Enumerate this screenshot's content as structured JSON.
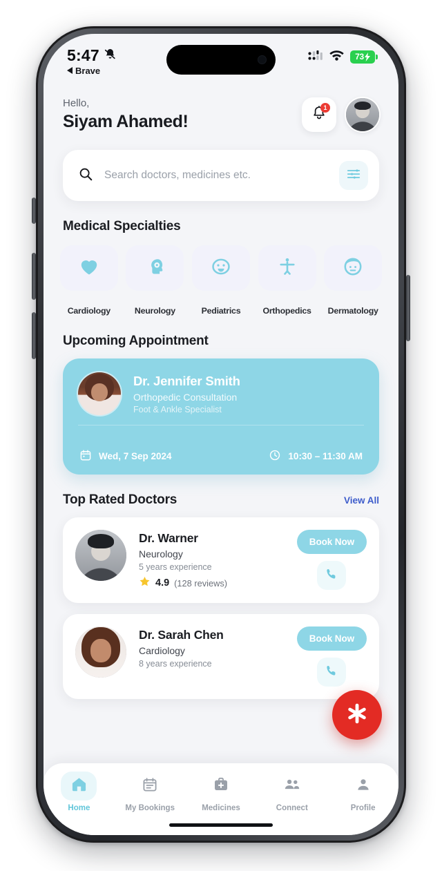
{
  "status_bar": {
    "time": "5:47",
    "silent_icon": "bell-slash-icon",
    "back_app_label": "Brave",
    "cellular_icon": "cellular-dots-icon",
    "wifi_icon": "wifi-icon",
    "battery_text": "73",
    "battery_color": "#2ad04f"
  },
  "header": {
    "greeting": "Hello,",
    "user_name": "Siyam Ahamed!",
    "notification_icon": "bell-icon",
    "notification_count": "1",
    "avatar_icon": "user-avatar"
  },
  "search": {
    "placeholder": "Search doctors, medicines etc.",
    "value": "",
    "search_icon": "search-icon",
    "filter_icon": "sliders-filter-icon"
  },
  "specialties": {
    "title": "Medical Specialties",
    "items": [
      {
        "label": "Cardiology",
        "icon": "heart-icon"
      },
      {
        "label": "Neurology",
        "icon": "brain-head-icon"
      },
      {
        "label": "Pediatrics",
        "icon": "baby-face-icon"
      },
      {
        "label": "Orthopedics",
        "icon": "body-person-icon"
      },
      {
        "label": "Dermatology",
        "icon": "face-skin-icon"
      }
    ]
  },
  "appointment": {
    "title": "Upcoming Appointment",
    "doctor_name": "Dr. Jennifer Smith",
    "consultation": "Orthopedic Consultation",
    "specialty_note": "Foot & Ankle Specialist",
    "date_icon": "calendar-icon",
    "date": "Wed, 7 Sep 2024",
    "time_icon": "clock-icon",
    "time": "10:30 – 11:30 AM",
    "card_color": "#8ed6e6"
  },
  "top_rated": {
    "title": "Top Rated Doctors",
    "view_all_label": "View All",
    "view_all_color": "#3d5ccb",
    "doctors": [
      {
        "name": "Dr. Warner",
        "specialty": "Neurology",
        "experience": "5 years experience",
        "rating": "4.9",
        "reviews": "(128 reviews)",
        "star_icon": "star-icon",
        "book_label": "Book Now",
        "call_icon": "phone-icon"
      },
      {
        "name": "Dr. Sarah Chen",
        "specialty": "Cardiology",
        "experience": "8 years experience",
        "rating": "",
        "reviews": "",
        "star_icon": "star-icon",
        "book_label": "Book Now",
        "call_icon": "phone-icon"
      }
    ]
  },
  "fab": {
    "icon": "emergency-asterisk-icon",
    "color": "#e32b24"
  },
  "bottom_nav": {
    "items": [
      {
        "label": "Home",
        "icon": "home-icon",
        "active": true
      },
      {
        "label": "My Bookings",
        "icon": "calendar-list-icon",
        "active": false
      },
      {
        "label": "Medicines",
        "icon": "medical-bag-icon",
        "active": false
      },
      {
        "label": "Connect",
        "icon": "people-icon",
        "active": false
      },
      {
        "label": "Profile",
        "icon": "person-icon",
        "active": false
      }
    ],
    "active_color": "#62c6da",
    "inactive_color": "#9aa0a9"
  }
}
